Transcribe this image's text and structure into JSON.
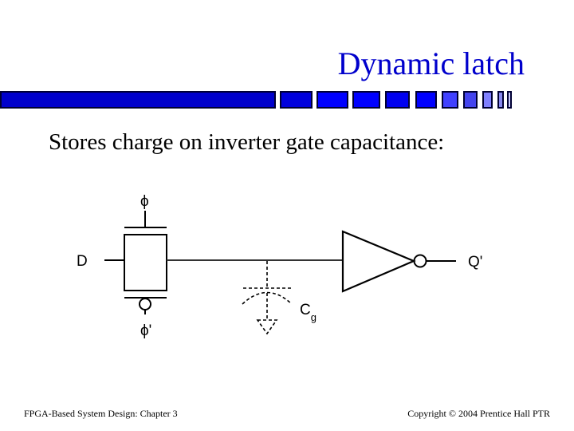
{
  "slide": {
    "title": "Dynamic latch",
    "bullet": "Stores charge on inverter gate capacitance:",
    "footer_left": "FPGA-Based System Design: Chapter 3",
    "footer_right": "Copyright © 2004  Prentice Hall PTR"
  },
  "decor_bar": {
    "block_colors": [
      "#0000CC",
      "#0000DD",
      "#0000FF",
      "#0000FF",
      "#0000F0",
      "#0000FF",
      "#4040FF",
      "#4444EE",
      "#8080FF",
      "#8888EE",
      "#C8C8FF",
      "#FFFFFF"
    ]
  },
  "circuit": {
    "input_label": "D",
    "clock_label": "ϕ",
    "clock_bar_label": "ϕ'",
    "output_label": "Q'",
    "cap_label": "C",
    "cap_subscript": "g",
    "elements": [
      "transmission-gate",
      "gate-capacitance",
      "inverter"
    ]
  }
}
